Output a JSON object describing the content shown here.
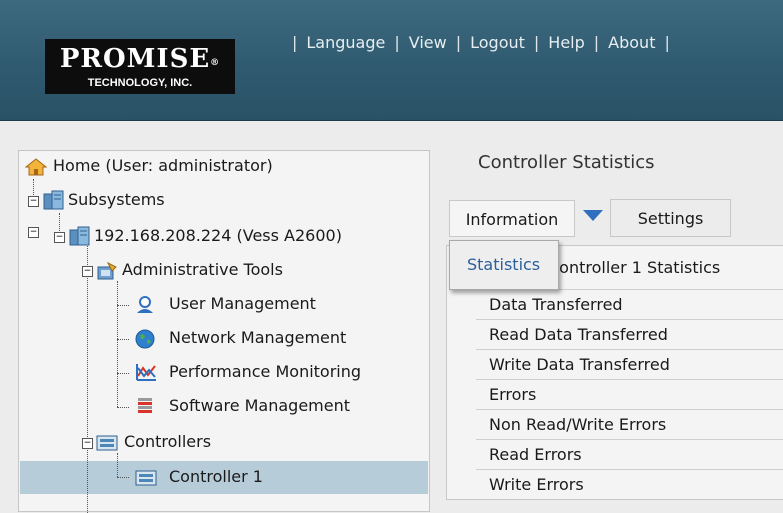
{
  "header": {
    "logo_line1": "PROMISE",
    "logo_registered": "®",
    "logo_line2": "TECHNOLOGY, INC.",
    "separator": "|",
    "nav": [
      "Language",
      "View",
      "Logout",
      "Help",
      "About"
    ]
  },
  "tree": {
    "home": "Home (User: administrator)",
    "subsystems": "Subsystems",
    "subsystem": "192.168.208.224 (Vess A2600)",
    "admin_tools": "Administrative Tools",
    "user_management": "User Management",
    "network_management": "Network Management",
    "performance_monitoring": "Performance Monitoring",
    "software_management": "Software Management",
    "controllers": "Controllers",
    "controller1": "Controller 1"
  },
  "main": {
    "title": "Controller Statistics",
    "tab_information": "Information",
    "tab_settings": "Settings",
    "dropdown_item": "Statistics",
    "table_header": "Controller 1 Statistics",
    "rows": [
      "Data Transferred",
      "Read Data Transferred",
      "Write Data Transferred",
      "Errors",
      "Non Read/Write Errors",
      "Read Errors",
      "Write Errors"
    ]
  },
  "colors": {
    "header_bg": "#2f5a70",
    "selected_row": "#b6ccd9",
    "caret": "#2e6fbe",
    "dropdown_text": "#2b5f9a"
  }
}
